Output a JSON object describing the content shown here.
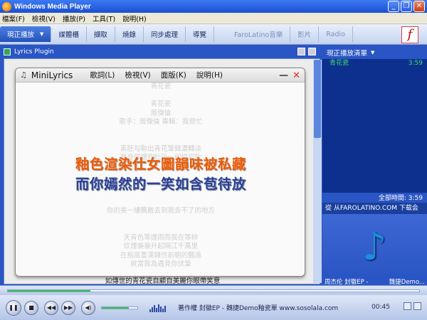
{
  "window": {
    "title": "Windows Media Player"
  },
  "menu": [
    "檔案(F)",
    "檢視(V)",
    "播放(P)",
    "工具(T)",
    "說明(H)"
  ],
  "tabs": [
    {
      "label": "現正播放"
    },
    {
      "label": "媒體櫃"
    },
    {
      "label": "擷取"
    },
    {
      "label": "燒錄"
    },
    {
      "label": "同步處理"
    },
    {
      "label": "導覽"
    },
    {
      "label": "FaroLatino音樂"
    },
    {
      "label": "影片"
    },
    {
      "label": "Radio"
    }
  ],
  "logo_letter": "f",
  "plugin": {
    "name": "Lyrics Plugin"
  },
  "bg_lyrics": [
    "",
    "",
    "",
    "",
    "",
    "",
    "",
    "",
    "",
    "",
    "",
    "",
    "",
    "",
    "",
    "",
    "",
    "",
    "",
    "",
    ""
  ],
  "under_line": "如傳世的青花瓷自顧自美麗你眼帶笑意",
  "minilyrics": {
    "name": "MiniLyrics",
    "menu": [
      "歌詞(L)",
      "檢視(V)",
      "面版(K)",
      "說明(H)"
    ],
    "lyrics": [
      "青花瓷",
      "",
      "青花瓷",
      "周傑倫",
      "歌手：周傑倫 專輯：我很忙",
      "",
      "",
      "素胚勾勒出青花筆鋒濃轉淡",
      "瓶身描繪的牡丹一如妳初妝",
      "",
      "",
      "",
      "",
      "",
      "你的美一縷飄散去到我去不了的地方",
      "",
      "",
      "天青色等煙雨而我在等妳",
      "炊煙裊裊升起隔江千萬里",
      "在瓶底書漢隸仿前朝的飄逸",
      "就當我為遇見你伏筆",
      "",
      "天青色等煙雨而我在等妳",
      "月色被打撈起暈開了結局"
    ],
    "highlight1": "釉色渲染仕女圖韻味被私藏",
    "highlight2": "而你嫣然的一笑如含苞待放"
  },
  "playlist": {
    "header": "現正播放清單",
    "items": [
      {
        "title": "青花瓷",
        "duration": "3:59"
      }
    ],
    "total": "全部時間: 3:59",
    "info": "從 从FAROLATINO.COM 下载会",
    "foot_left": "周杰伦 封徽EP -",
    "foot_right": "魏捷Demo..."
  },
  "player": {
    "seek_fraction": 0.2,
    "volume_fraction": 0.75,
    "now_playing": "著作權 封徽EP - 魏捷Demo釉瓷單 www.sosolala.com",
    "time": "00:45"
  },
  "colors": {
    "accent": "#2a55c4",
    "highlight_orange": "#e85c0a",
    "highlight_blue": "#2a3f92",
    "playlist_text": "#3ee06a"
  },
  "icons": [
    "media-player-icon",
    "minimize-icon",
    "restore-icon",
    "close-icon",
    "music-note-icon",
    "pause-icon",
    "stop-icon",
    "previous-icon",
    "next-icon",
    "mute-icon"
  ]
}
